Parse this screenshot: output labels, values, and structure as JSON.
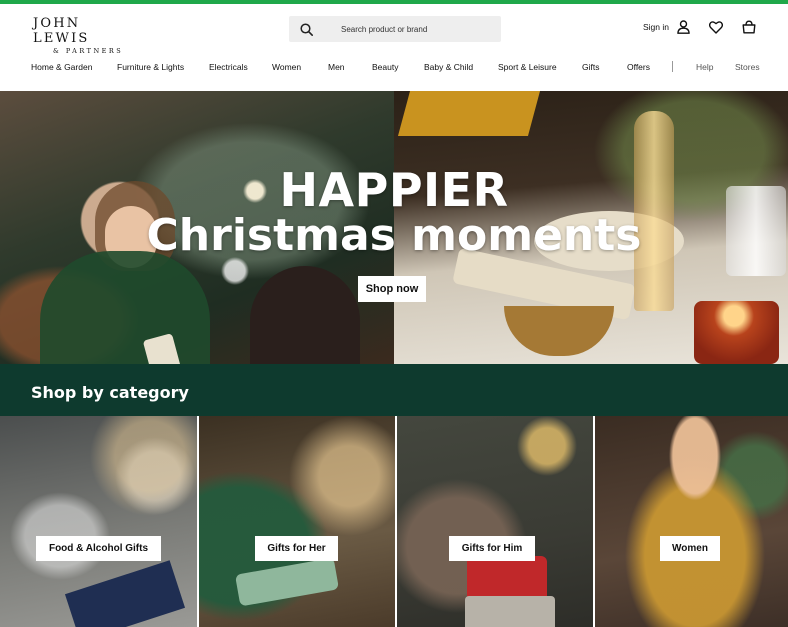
{
  "brand": {
    "name": "JOHN LEWIS",
    "sub": "& PARTNERS"
  },
  "search": {
    "placeholder": "Search product or brand"
  },
  "account": {
    "signin_label": "Sign in"
  },
  "nav": {
    "items": [
      "Home & Garden",
      "Furniture & Lights",
      "Electricals",
      "Women",
      "Men",
      "Beauty",
      "Baby & Child",
      "Sport & Leisure",
      "Gifts",
      "Offers"
    ],
    "utility": [
      "Help",
      "Stores"
    ]
  },
  "hero": {
    "title_line1": "HAPPIER",
    "title_line2": "Christmas moments",
    "cta": "Shop now"
  },
  "categories": {
    "heading": "Shop by category",
    "tiles": [
      {
        "label": "Food & Alcohol Gifts"
      },
      {
        "label": "Gifts for Her"
      },
      {
        "label": "Gifts for Him"
      },
      {
        "label": "Women"
      }
    ]
  },
  "colors": {
    "accent_bar": "#20a84a",
    "category_band": "#0e3a2e"
  },
  "icons": [
    "search-icon",
    "user-icon",
    "heart-icon",
    "basket-icon"
  ]
}
